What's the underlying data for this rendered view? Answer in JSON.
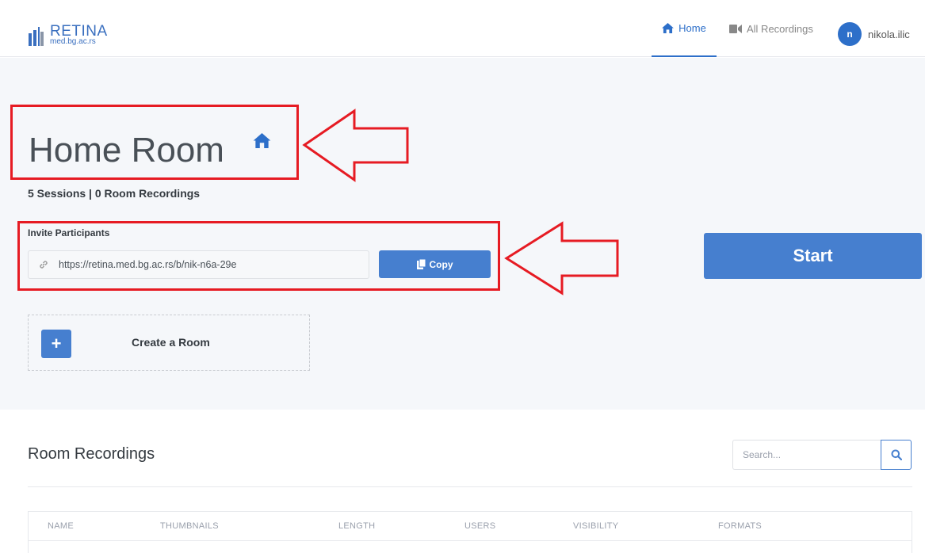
{
  "navbar": {
    "logo": {
      "name": "RETINA",
      "domain": "med.bg.ac.rs"
    },
    "links": [
      {
        "label": "Home",
        "icon": "home-icon",
        "active": true
      },
      {
        "label": "All Recordings",
        "icon": "video-camera-icon",
        "active": false
      }
    ],
    "user": {
      "initial": "n",
      "name": "nikola.ilic"
    }
  },
  "room": {
    "title": "Home Room",
    "stats": "5 Sessions | 0 Room Recordings",
    "invite_label": "Invite Participants",
    "invite_url": "https://retina.med.bg.ac.rs/b/nik-n6a-29e",
    "copy_label": "Copy",
    "start_label": "Start",
    "create_plus": "+",
    "create_label": "Create a Room"
  },
  "recordings": {
    "title": "Room Recordings",
    "search_placeholder": "Search...",
    "columns": [
      "NAME",
      "THUMBNAILS",
      "LENGTH",
      "USERS",
      "VISIBILITY",
      "FORMATS"
    ]
  },
  "colors": {
    "accent": "#467fcf",
    "annotation": "#e61b23",
    "section_bg": "#f5f7fa"
  }
}
